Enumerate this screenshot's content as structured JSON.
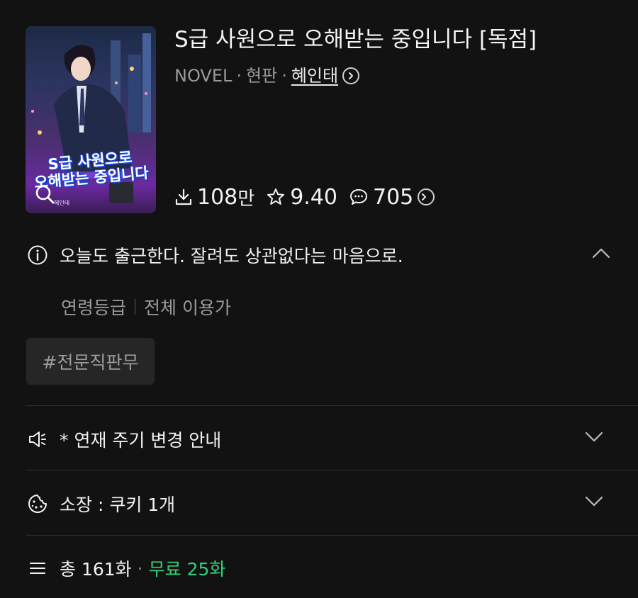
{
  "cover": {
    "title_line1": "S급 사원으로",
    "title_line2": "오해받는 중입니다",
    "author_small": "혜인태"
  },
  "title": "S급 사원으로 오해받는 중입니다 [독점]",
  "meta": {
    "category": "NOVEL",
    "genre": "현판",
    "author": "혜인태"
  },
  "stats": {
    "downloads": "108",
    "downloads_unit": "만",
    "rating": "9.40",
    "comments": "705"
  },
  "synopsis": "오늘도 출근한다. 잘려도 상관없다는 마음으로.",
  "age_rating": {
    "label": "연령등급",
    "value": "전체 이용가"
  },
  "tag": "#전문직판무",
  "notice": "* 연재 주기 변경 안내",
  "owned": "소장 : 쿠키 1개",
  "episodes": {
    "total": "총 161화",
    "free": "무료 25화"
  },
  "colors": {
    "background": "#121212",
    "free_accent": "#33d17a"
  }
}
